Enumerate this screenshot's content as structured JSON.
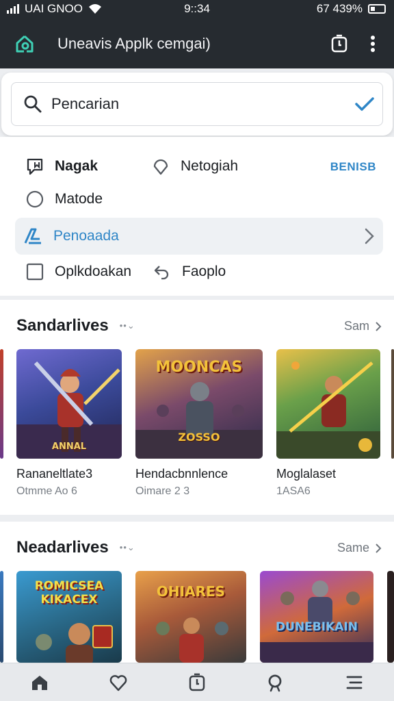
{
  "status_bar": {
    "carrier": "UAI GNOO",
    "time": "9::34",
    "battery_text": "67 439%"
  },
  "header": {
    "title": "Uneavis Applk cemgai)"
  },
  "search": {
    "value": "Pencarian"
  },
  "options": {
    "link": "BENISB",
    "items": [
      {
        "label": "Nagak",
        "icon": "bookmark-icon"
      },
      {
        "label": "Netogiah",
        "icon": "location-pin-icon"
      },
      {
        "label": "Matode",
        "icon": "radio-icon"
      },
      {
        "label": "Penoaada",
        "icon": "brand-icon"
      },
      {
        "label": "Oplkdoakan",
        "icon": "checkbox-icon"
      },
      {
        "label": "Faoplo",
        "icon": "undo-icon"
      }
    ]
  },
  "sections": [
    {
      "title": "Sandarlives",
      "link": "Sam",
      "cards": [
        {
          "name": "Rananeltlate3",
          "meta": "Otmme Ao 6",
          "art_label": "ANNAL"
        },
        {
          "name": "Hendacbnnlence",
          "meta": "Oimare 2 3",
          "art_title": "MOONCAS",
          "art_label": "ZOSSO"
        },
        {
          "name": "Moglalaset",
          "meta": "1ASA6"
        }
      ]
    },
    {
      "title": "Neadarlives",
      "link": "Same",
      "cards": [
        {
          "art_title": "ROMICSEA",
          "art_subtitle": "KIKACEX"
        },
        {
          "art_title": "OHIARES"
        },
        {
          "art_title": "DUNEBIKAIN"
        }
      ]
    }
  ],
  "colors": {
    "header_bg": "#262b30",
    "accent": "#2f86c7",
    "teal": "#3fd0b5"
  }
}
